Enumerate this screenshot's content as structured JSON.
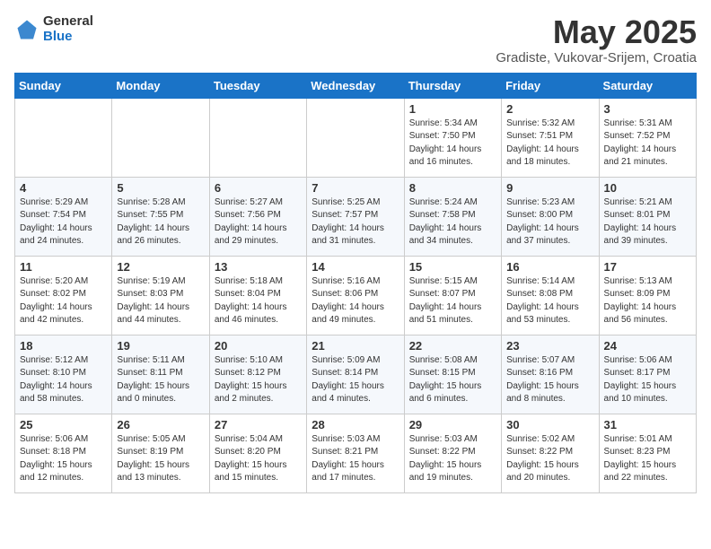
{
  "logo": {
    "general": "General",
    "blue": "Blue"
  },
  "title": "May 2025",
  "subtitle": "Gradiste, Vukovar-Srijem, Croatia",
  "days_of_week": [
    "Sunday",
    "Monday",
    "Tuesday",
    "Wednesday",
    "Thursday",
    "Friday",
    "Saturday"
  ],
  "weeks": [
    [
      {
        "day": "",
        "content": ""
      },
      {
        "day": "",
        "content": ""
      },
      {
        "day": "",
        "content": ""
      },
      {
        "day": "",
        "content": ""
      },
      {
        "day": "1",
        "content": "Sunrise: 5:34 AM\nSunset: 7:50 PM\nDaylight: 14 hours\nand 16 minutes."
      },
      {
        "day": "2",
        "content": "Sunrise: 5:32 AM\nSunset: 7:51 PM\nDaylight: 14 hours\nand 18 minutes."
      },
      {
        "day": "3",
        "content": "Sunrise: 5:31 AM\nSunset: 7:52 PM\nDaylight: 14 hours\nand 21 minutes."
      }
    ],
    [
      {
        "day": "4",
        "content": "Sunrise: 5:29 AM\nSunset: 7:54 PM\nDaylight: 14 hours\nand 24 minutes."
      },
      {
        "day": "5",
        "content": "Sunrise: 5:28 AM\nSunset: 7:55 PM\nDaylight: 14 hours\nand 26 minutes."
      },
      {
        "day": "6",
        "content": "Sunrise: 5:27 AM\nSunset: 7:56 PM\nDaylight: 14 hours\nand 29 minutes."
      },
      {
        "day": "7",
        "content": "Sunrise: 5:25 AM\nSunset: 7:57 PM\nDaylight: 14 hours\nand 31 minutes."
      },
      {
        "day": "8",
        "content": "Sunrise: 5:24 AM\nSunset: 7:58 PM\nDaylight: 14 hours\nand 34 minutes."
      },
      {
        "day": "9",
        "content": "Sunrise: 5:23 AM\nSunset: 8:00 PM\nDaylight: 14 hours\nand 37 minutes."
      },
      {
        "day": "10",
        "content": "Sunrise: 5:21 AM\nSunset: 8:01 PM\nDaylight: 14 hours\nand 39 minutes."
      }
    ],
    [
      {
        "day": "11",
        "content": "Sunrise: 5:20 AM\nSunset: 8:02 PM\nDaylight: 14 hours\nand 42 minutes."
      },
      {
        "day": "12",
        "content": "Sunrise: 5:19 AM\nSunset: 8:03 PM\nDaylight: 14 hours\nand 44 minutes."
      },
      {
        "day": "13",
        "content": "Sunrise: 5:18 AM\nSunset: 8:04 PM\nDaylight: 14 hours\nand 46 minutes."
      },
      {
        "day": "14",
        "content": "Sunrise: 5:16 AM\nSunset: 8:06 PM\nDaylight: 14 hours\nand 49 minutes."
      },
      {
        "day": "15",
        "content": "Sunrise: 5:15 AM\nSunset: 8:07 PM\nDaylight: 14 hours\nand 51 minutes."
      },
      {
        "day": "16",
        "content": "Sunrise: 5:14 AM\nSunset: 8:08 PM\nDaylight: 14 hours\nand 53 minutes."
      },
      {
        "day": "17",
        "content": "Sunrise: 5:13 AM\nSunset: 8:09 PM\nDaylight: 14 hours\nand 56 minutes."
      }
    ],
    [
      {
        "day": "18",
        "content": "Sunrise: 5:12 AM\nSunset: 8:10 PM\nDaylight: 14 hours\nand 58 minutes."
      },
      {
        "day": "19",
        "content": "Sunrise: 5:11 AM\nSunset: 8:11 PM\nDaylight: 15 hours\nand 0 minutes."
      },
      {
        "day": "20",
        "content": "Sunrise: 5:10 AM\nSunset: 8:12 PM\nDaylight: 15 hours\nand 2 minutes."
      },
      {
        "day": "21",
        "content": "Sunrise: 5:09 AM\nSunset: 8:14 PM\nDaylight: 15 hours\nand 4 minutes."
      },
      {
        "day": "22",
        "content": "Sunrise: 5:08 AM\nSunset: 8:15 PM\nDaylight: 15 hours\nand 6 minutes."
      },
      {
        "day": "23",
        "content": "Sunrise: 5:07 AM\nSunset: 8:16 PM\nDaylight: 15 hours\nand 8 minutes."
      },
      {
        "day": "24",
        "content": "Sunrise: 5:06 AM\nSunset: 8:17 PM\nDaylight: 15 hours\nand 10 minutes."
      }
    ],
    [
      {
        "day": "25",
        "content": "Sunrise: 5:06 AM\nSunset: 8:18 PM\nDaylight: 15 hours\nand 12 minutes."
      },
      {
        "day": "26",
        "content": "Sunrise: 5:05 AM\nSunset: 8:19 PM\nDaylight: 15 hours\nand 13 minutes."
      },
      {
        "day": "27",
        "content": "Sunrise: 5:04 AM\nSunset: 8:20 PM\nDaylight: 15 hours\nand 15 minutes."
      },
      {
        "day": "28",
        "content": "Sunrise: 5:03 AM\nSunset: 8:21 PM\nDaylight: 15 hours\nand 17 minutes."
      },
      {
        "day": "29",
        "content": "Sunrise: 5:03 AM\nSunset: 8:22 PM\nDaylight: 15 hours\nand 19 minutes."
      },
      {
        "day": "30",
        "content": "Sunrise: 5:02 AM\nSunset: 8:22 PM\nDaylight: 15 hours\nand 20 minutes."
      },
      {
        "day": "31",
        "content": "Sunrise: 5:01 AM\nSunset: 8:23 PM\nDaylight: 15 hours\nand 22 minutes."
      }
    ]
  ]
}
